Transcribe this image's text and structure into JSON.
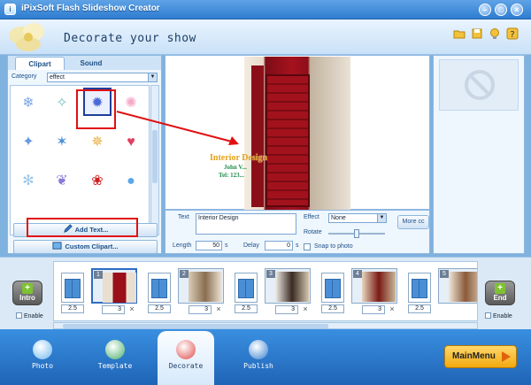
{
  "window": {
    "title": "iPixSoft Flash Slideshow Creator"
  },
  "header": {
    "title": "Decorate your show"
  },
  "left_panel": {
    "tabs": [
      {
        "label": "Clipart"
      },
      {
        "label": "Sound"
      }
    ],
    "category": {
      "label": "Category",
      "value": "effect"
    },
    "add_text": "Add Text...",
    "custom_clipart": "Custom Clipart..."
  },
  "preview": {
    "overlay_title": "Interior Design",
    "overlay_line2": "John V...",
    "overlay_line3": "Tel:  123..."
  },
  "props": {
    "text_label": "Text",
    "text_value": "Interior Design",
    "effect_label": "Effect",
    "effect_value": "None",
    "rotate_label": "Rotate",
    "more_label": "More cc",
    "length_label": "Length",
    "length_value": "50",
    "length_unit": "s",
    "delay_label": "Delay",
    "delay_value": "0",
    "delay_unit": "s",
    "snap_label": "Snap to photo"
  },
  "timeline": {
    "intro": "Intro",
    "end": "End",
    "enable": "Enable",
    "transition_duration": "2.5",
    "slides": [
      {
        "num": "1",
        "duration": "3"
      },
      {
        "num": "2",
        "duration": "3"
      },
      {
        "num": "3",
        "duration": "3"
      },
      {
        "num": "4",
        "duration": "3"
      },
      {
        "num": "5",
        "duration": ""
      }
    ]
  },
  "nav": {
    "items": [
      {
        "label": "Photo"
      },
      {
        "label": "Template"
      },
      {
        "label": "Decorate"
      },
      {
        "label": "Publish"
      }
    ],
    "main_menu": "MainMenu"
  }
}
